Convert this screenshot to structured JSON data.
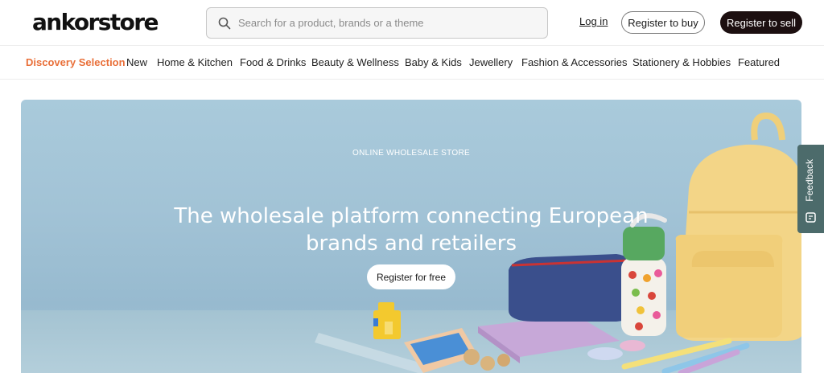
{
  "header": {
    "logo": "ankorstore",
    "search_placeholder": "Search for a product, brands or a theme",
    "login_label": "Log in",
    "register_buy_label": "Register to buy",
    "register_sell_label": "Register to sell"
  },
  "nav": {
    "items": [
      "Discovery Selection",
      "New",
      "Home & Kitchen",
      "Food & Drinks",
      "Beauty & Wellness",
      "Baby & Kids",
      "Jewellery",
      "Fashion & Accessories",
      "Stationery & Hobbies",
      "Featured"
    ],
    "active_index": 0
  },
  "hero": {
    "eyebrow": "ONLINE WHOLESALE STORE",
    "title": "The wholesale platform connecting European brands and retailers",
    "cta_label": "Register for free"
  },
  "feedback": {
    "label": "Feedback"
  },
  "colors": {
    "accent": "#e9703a",
    "dark_button": "#1c0f10",
    "feedback_tab": "#4c6b6b",
    "hero_background": "#a2c3d6"
  },
  "icons": {
    "search": "search-icon",
    "feedback": "feedback-icon"
  }
}
